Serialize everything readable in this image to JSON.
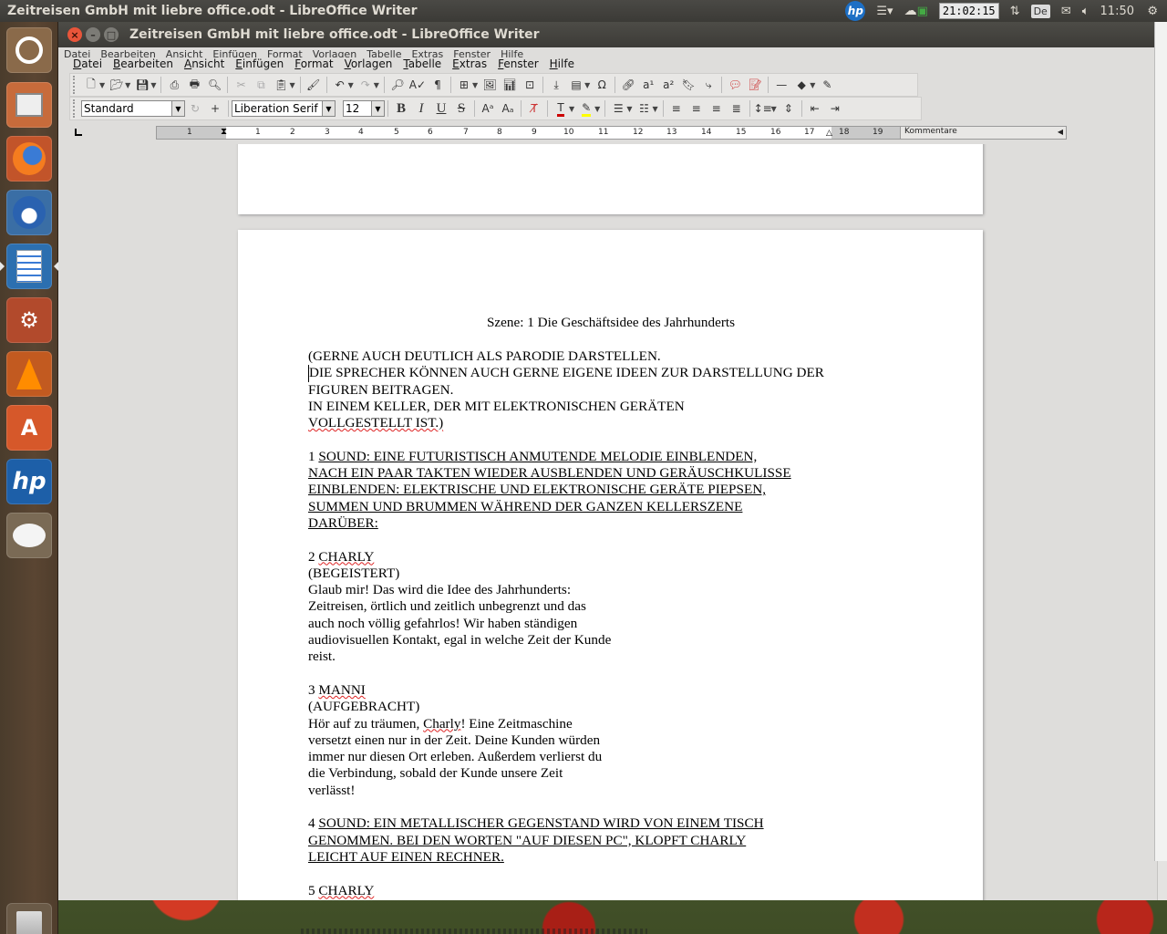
{
  "panel": {
    "title": "Zeitreisen GmbH mit liebre office.odt - LibreOffice Writer",
    "clock_box": "21:02:15",
    "keyboard": "De",
    "time": "11:50"
  },
  "window": {
    "title": "Zeitreisen GmbH mit liebre office.odt - LibreOffice Writer",
    "menu_ghost": [
      "Datei",
      "Bearbeiten",
      "Ansicht",
      "Einfügen",
      "Format",
      "Vorlagen",
      "Tabelle",
      "Extras",
      "Fenster",
      "Hilfe"
    ],
    "menu": [
      "Datei",
      "Bearbeiten",
      "Ansicht",
      "Einfügen",
      "Format",
      "Vorlagen",
      "Tabelle",
      "Extras",
      "Fenster",
      "Hilfe"
    ]
  },
  "formatting": {
    "paragraph_style": "Standard",
    "font_name": "Liberation Serif",
    "font_size": "12"
  },
  "ruler": {
    "ticks": [
      "1",
      "1",
      "2",
      "3",
      "4",
      "5",
      "6",
      "7",
      "8",
      "9",
      "10",
      "11",
      "12",
      "13",
      "14",
      "15",
      "16",
      "17",
      "18",
      "19"
    ],
    "comments_label": "Kommentare"
  },
  "document": {
    "heading": "Szene: 1 Die Geschäftsidee des Jahrhunderts",
    "intro": [
      "(GERNE AUCH DEUTLICH ALS PARODIE DARSTELLEN.",
      "DIE SPRECHER KÖNNEN AUCH GERNE EIGENE IDEEN ZUR DARSTELLUNG DER",
      "FIGUREN BEITRAGEN.",
      "IN EINEM KELLER, DER MIT ELEKTRONISCHEN GERÄTEN",
      "VOLLGESTELLT IST.)"
    ],
    "sound1_number": "1 ",
    "sound1": [
      "SOUND: EINE FUTURISTISCH ANMUTENDE MELODIE EINBLENDEN,",
      "NACH EIN PAAR TAKTEN WIEDER AUSBLENDEN UND GERÄUSCHKULISSE",
      "EINBLENDEN: ELEKTRISCHE UND ELEKTRONISCHE GERÄTE PIEPSEN,",
      "SUMMEN UND BRUMMEN WÄHREND DER GANZEN KELLERSZENE",
      "DARÜBER:"
    ],
    "line2_number": "2 ",
    "line2_speaker": "CHARLY",
    "line2_direction": "(BEGEISTERT)",
    "line2_text": [
      "Glaub mir! Das wird die Idee des Jahrhunderts:",
      "Zeitreisen, örtlich und zeitlich unbegrenzt und das",
      "auch noch völlig gefahrlos! Wir haben ständigen",
      "audiovisuellen Kontakt, egal in welche Zeit der Kunde",
      "reist."
    ],
    "line3_number": "3 ",
    "line3_speaker": "MANNI",
    "line3_direction": "(AUFGEBRACHT)",
    "line3_text_a": "Hör auf zu träumen, ",
    "line3_text_b": "Charly",
    "line3_text_c": "! Eine Zeitmaschine",
    "line3_text": [
      "versetzt einen nur in der Zeit. Deine Kunden würden",
      "immer nur diesen Ort erleben. Außerdem verlierst du",
      "die Verbindung, sobald der Kunde unsere Zeit",
      "verlässt!"
    ],
    "sound4_number": "4 ",
    "sound4": [
      "SOUND: EIN METALLISCHER GEGENSTAND WIRD VON EINEM TISCH",
      "GENOMMEN. BEI DEN WORTEN \"AUF DIESEN PC\", KLOPFT CHARLY",
      "LEICHT AUF EINEN RECHNER."
    ],
    "line5_number": "5 ",
    "line5_speaker": "CHARLY"
  },
  "colors": {
    "launcher_bg": "#5a4532",
    "panel_bg": "#3c3b37",
    "close_button": "#e9553a"
  }
}
